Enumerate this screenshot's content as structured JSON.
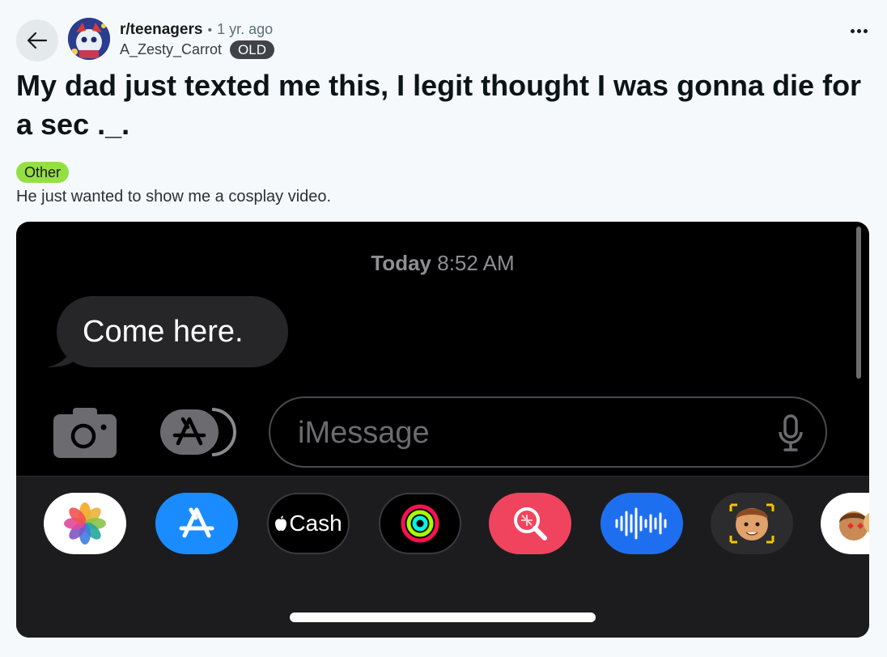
{
  "header": {
    "subreddit": "r/teenagers",
    "separator": "•",
    "age": "1 yr. ago",
    "username": "A_Zesty_Carrot",
    "user_badge": "OLD",
    "back_icon": "arrow-left-icon",
    "more_icon": "more-horizontal-icon"
  },
  "post": {
    "title": "My dad just texted me this, I legit thought I was gonna die for a sec ._.",
    "flair": "Other",
    "flair_color": "#94e044",
    "body": "He just wanted to show me a cosplay video."
  },
  "screenshot": {
    "timestamp_day": "Today",
    "timestamp_time": "8:52 AM",
    "message": "Come here.",
    "input_placeholder": "iMessage",
    "app_tray": [
      "Photos",
      "App Store",
      "Cash",
      "Activity",
      "Images Search",
      "Audio Message",
      "Memoji",
      "Memoji Stickers"
    ],
    "cash_label": "Cash",
    "colors": {
      "background": "#000000",
      "bubble": "#262628",
      "tray": "#1c1c1e",
      "app_store_blue": "#1a8cff",
      "search_red": "#f0445e",
      "audio_blue": "#1e6ff0"
    }
  }
}
